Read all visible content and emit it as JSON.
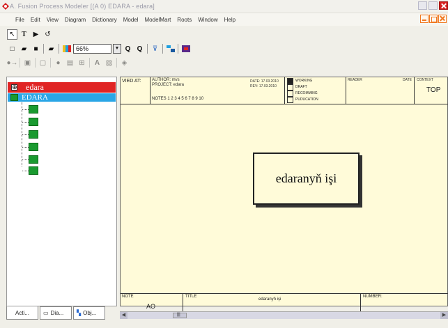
{
  "window": {
    "title": "A. Fusion Process Modeler  [(A 0) EDARA - edara]",
    "colors": {
      "accent": "#f07820",
      "close": "#d62020",
      "canvas": "#fffbd9",
      "root_node": "#e02424",
      "selected_node": "#2aa6e6",
      "child_node": "#1a9a30"
    }
  },
  "menubar": {
    "items": [
      "File",
      "Edit",
      "View",
      "Diagram",
      "Dictionary",
      "Model",
      "ModelMart",
      "Roots",
      "Window",
      "Help"
    ]
  },
  "toolbar1": {
    "icons": [
      "pointer-icon",
      "text-tool-icon",
      "arrow-tool-icon",
      "undo-icon"
    ]
  },
  "toolbar2": {
    "icons": [
      "new-icon",
      "open-icon",
      "save-icon",
      "print-icon",
      "color-icon"
    ],
    "zoom_value": "66%",
    "zoom_icons": [
      "zoom-in-icon",
      "zoom-out-icon",
      "filter-icon",
      "layout-icon",
      "model-icon"
    ]
  },
  "toolbar3": {
    "icons": [
      "nav-back-icon",
      "nav-page-icon",
      "nav-disk-icon",
      "nav-copy-icon",
      "nav-activity-icon",
      "nav-grid-icon",
      "nav-font-icon",
      "nav-image-icon",
      "nav-step-icon"
    ]
  },
  "tree": {
    "root_label": "edara",
    "expand_glyph": "⊕",
    "child_label": "EDARA",
    "children_count_label": ""
  },
  "bottom_tabs": [
    {
      "label": "Acti..."
    },
    {
      "label": "Dia..."
    },
    {
      "label": "Obj..."
    }
  ],
  "diagram": {
    "header": {
      "used_at": "VIED AT:",
      "author": "AUTHOR: mvs",
      "project": "PROJECT: edara",
      "notes": "NOTES  1  2  3  4  5  6  7  8  9  10",
      "date": "DATE:  17.03.2010",
      "rev": "REV:  17.03.2010",
      "status": [
        "WORKING",
        "DRAFT",
        "RECOMMING",
        "PUDUCATION"
      ],
      "reader": "READER",
      "reader_date": "DATE",
      "context": "CONTEXT",
      "context_value": "TOP"
    },
    "activity_box": "edaranyň işi",
    "footer": {
      "note": "NOTE",
      "note_value": "AO",
      "title": "TITLE",
      "title_value": "edaranyň işi",
      "number": "NUMBER:"
    },
    "scroll_thumb": "|||"
  }
}
